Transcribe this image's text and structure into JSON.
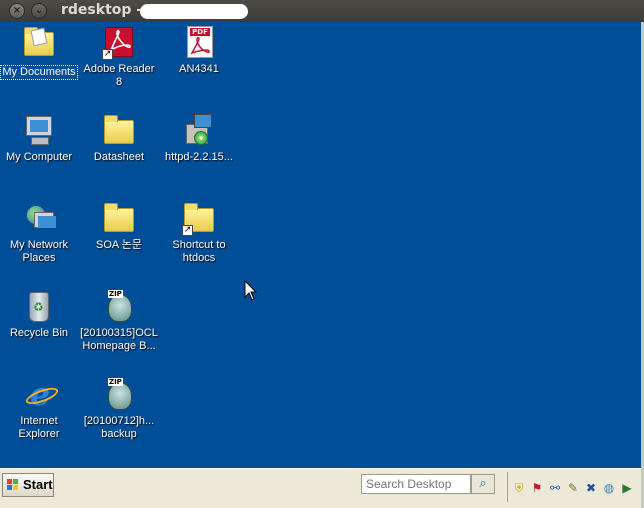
{
  "window": {
    "title": "rdesktop -",
    "controls": [
      "close",
      "minimize"
    ]
  },
  "desktop": {
    "background": "#004e98",
    "icons": [
      {
        "label": "My Documents",
        "type": "folder-docs",
        "selected": true
      },
      {
        "label": "Adobe Reader\n8",
        "type": "adobe-reader",
        "shortcut": true
      },
      {
        "label": "AN4341",
        "type": "pdf"
      },
      {
        "label": "My Computer",
        "type": "computer"
      },
      {
        "label": "Datasheet",
        "type": "folder"
      },
      {
        "label": "httpd-2.2.15...",
        "type": "installer"
      },
      {
        "label": "My Network\nPlaces",
        "type": "network"
      },
      {
        "label": "SOA 논문",
        "type": "folder"
      },
      {
        "label": "Shortcut to\nhtdocs",
        "type": "folder",
        "shortcut": true
      },
      {
        "label": "Recycle Bin",
        "type": "recycle-bin"
      },
      {
        "label": "[20100315]OCL\nHomepage B...",
        "type": "zip"
      },
      {
        "label": "Internet\nExplorer",
        "type": "internet-explorer"
      },
      {
        "label": "[20100712]h...\nbackup",
        "type": "zip"
      }
    ]
  },
  "taskbar": {
    "start_label": "Start",
    "search_placeholder": "Search Desktop",
    "tray_icons": [
      "shield-icon",
      "flag-icon",
      "network-icon",
      "pen-icon",
      "tools-icon",
      "globe-icon",
      "media-icon"
    ]
  }
}
